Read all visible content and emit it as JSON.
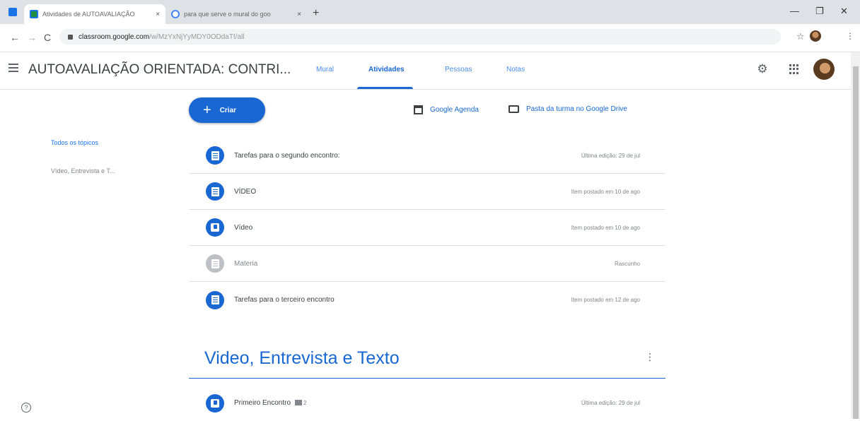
{
  "browser": {
    "tabs": [
      {
        "title": "Atividades de AUTOAVALIAÇÃO",
        "close": "×",
        "active": true
      },
      {
        "title": "para que serve o mural do goo",
        "close": "×",
        "active": false
      }
    ],
    "new_tab": "+",
    "window_controls": {
      "minimize": "—",
      "maximize": "❐",
      "close": "✕"
    },
    "back": "←",
    "forward": "→",
    "reload": "C",
    "url_host": "classroom.google.com",
    "url_path": "/w/MzYxNjYyMDY0ODdaTt/all",
    "bookmark_star": "☆",
    "menu": "⋮"
  },
  "header": {
    "class_title": "AUTOAVALIAÇÃO ORIENTADA: CONTRI...",
    "tabs": [
      {
        "label": "Mural"
      },
      {
        "label": "Atividades"
      },
      {
        "label": "Pessoas"
      },
      {
        "label": "Notas"
      }
    ]
  },
  "sidebar": {
    "all_topics": "Todos os tópicos",
    "topic_item": "Vídeo, Entrevista e T..."
  },
  "toolbar": {
    "create_label": "Criar",
    "create_plus": "+",
    "calendar_label": "Google Agenda",
    "drive_label": "Pasta da turma no Google Drive"
  },
  "items": [
    {
      "title": "Tarefas para o segundo encontro:",
      "meta": "Última edição: 29 de jul"
    },
    {
      "title": "VÍDEO",
      "meta": "Item postado em 10 de ago"
    },
    {
      "title": "Vídeo",
      "meta": "Item postado em 10 de ago"
    },
    {
      "title": "Materia",
      "meta": "Rascunho"
    },
    {
      "title": "Tarefas para o terceiro encontro",
      "meta": "Item postado em 12 de ago"
    }
  ],
  "section": {
    "title": "Video, Entrevista e Texto",
    "more": "⋮",
    "items": [
      {
        "title": "Primeiro Encontro",
        "attachments": "2",
        "meta": "Última edição: 29 de jul"
      }
    ]
  },
  "help": "?",
  "colors": {
    "primary": "#1967d2",
    "muted": "#bdc1c6"
  }
}
